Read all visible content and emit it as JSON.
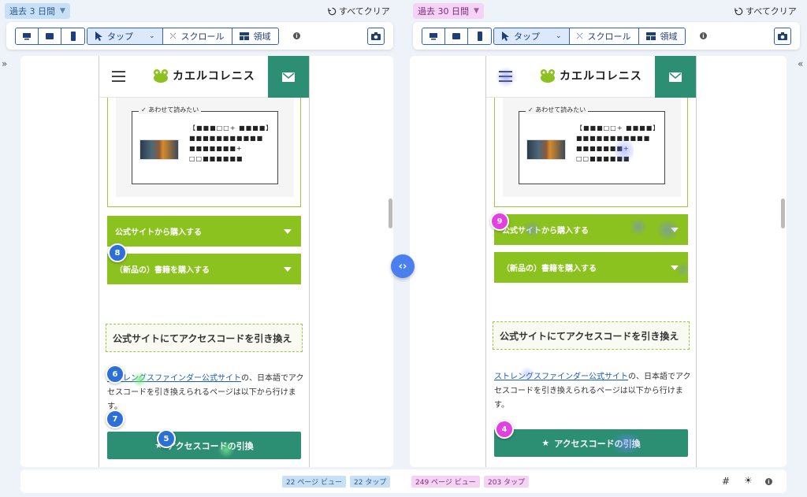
{
  "left": {
    "period": "過去 3 日間",
    "clear_label": "すべてクリア",
    "modes": {
      "tap": "タップ",
      "scroll": "スクロール",
      "area": "領域"
    },
    "page": {
      "logo_text": "カエルコレニス",
      "related_label": "あわせて読みたい",
      "related_text": "【■■■□□+ ■■■■】 ■■■■■■■■■■■ ■■■■■■■+ □□■■■■■■",
      "accordion1": "公式サイトから購入する",
      "accordion2": "（新品の）書籍を購入する",
      "heading": "公式サイトにてアクセスコードを引き換え",
      "link_text": "ストレングスファインダー公式サイト",
      "para_rest": "の、日本語でアクセスコードを引き換えられるページは以下から行けます。",
      "cta": "アクセスコードの引換"
    },
    "pins": [
      "8",
      "6",
      "7",
      "5"
    ],
    "stats": {
      "pageviews": "22 ページ ビュー",
      "taps": "22 タップ"
    }
  },
  "right": {
    "period": "過去 30 日間",
    "clear_label": "すべてクリア",
    "modes": {
      "tap": "タップ",
      "scroll": "スクロール",
      "area": "領域"
    },
    "page": {
      "logo_text": "カエルコレニス",
      "related_label": "あわせて読みたい",
      "related_text": "【■■■□□+ ■■■■】 ■■■■■■■■■■■ ■■■■■■■+ □□■■■■■■",
      "accordion1": "公式サイトから購入する",
      "accordion2": "（新品の）書籍を購入する",
      "heading": "公式サイトにてアクセスコードを引き換え",
      "link_text": "ストレングスファインダー公式サイト",
      "para_rest": "の、日本語でアクセスコードを引き換えられるページは以下から行けます。",
      "cta": "アクセスコードの引換"
    },
    "pins": [
      "9",
      "4"
    ],
    "stats": {
      "pageviews": "249 ページ ビュー",
      "taps": "203 タップ"
    }
  },
  "colors": {
    "brand_green": "#8cc21f",
    "cta_teal": "#2c8f73",
    "left_accent": "#c7e0f7",
    "right_accent": "#f5d3f5",
    "toolbar_blue": "#2c62c7"
  },
  "icons": [
    "desktop-icon",
    "tablet-icon",
    "mobile-icon",
    "pointer-icon",
    "scroll-icon",
    "area-icon",
    "info-icon",
    "camera-icon",
    "reset-icon",
    "swap-icon",
    "grid-settings-icon",
    "sun-icon"
  ]
}
